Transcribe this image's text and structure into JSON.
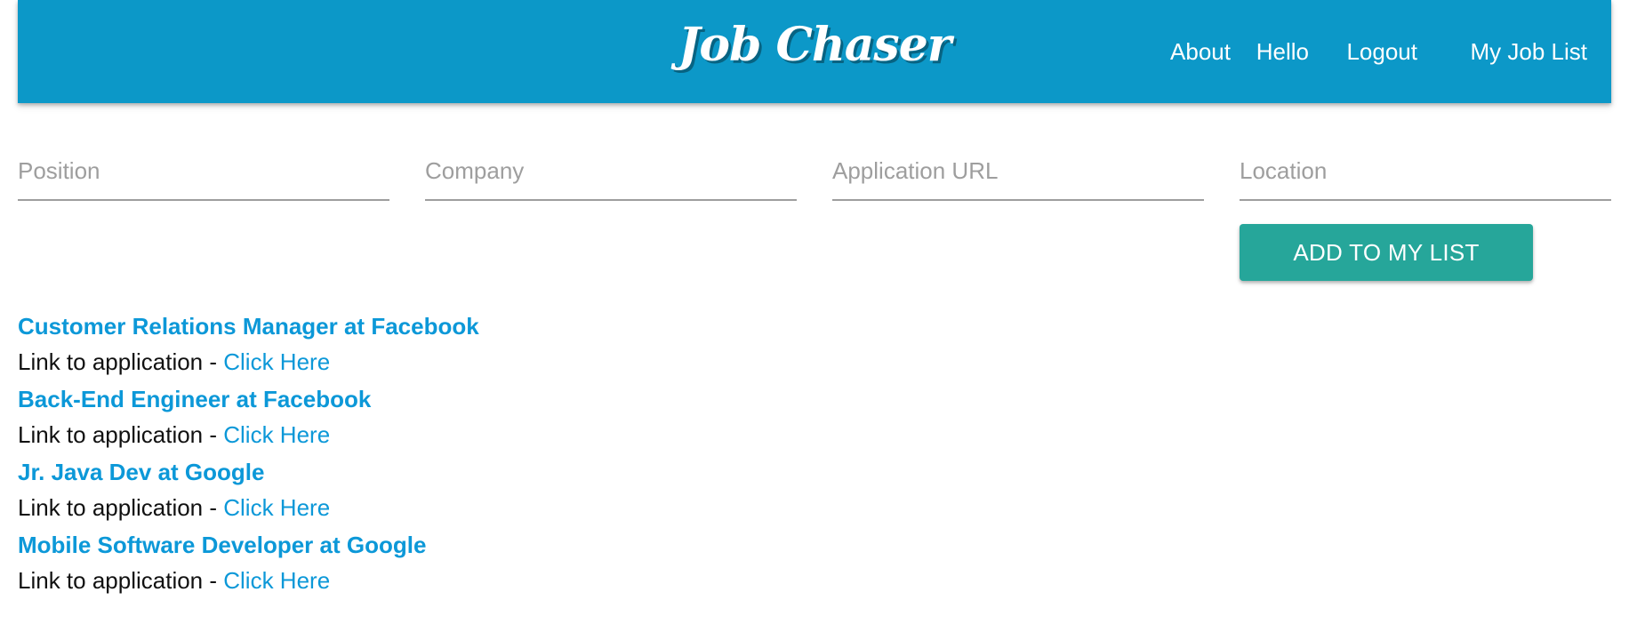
{
  "header": {
    "brand": "Job Chaser",
    "nav": [
      "About",
      "Hello",
      "Logout",
      "My Job List"
    ]
  },
  "form": {
    "position_placeholder": "Position",
    "company_placeholder": "Company",
    "url_placeholder": "Application URL",
    "location_placeholder": "Location",
    "add_button_label": "ADD TO MY LIST"
  },
  "jobs": [
    {
      "title": "Customer Relations Manager at Facebook",
      "link_prefix": "Link to application",
      "separator": " - ",
      "link_label": "Click Here"
    },
    {
      "title": "Back-End Engineer at Facebook",
      "link_prefix": "Link to application",
      "separator": " - ",
      "link_label": "Click Here"
    },
    {
      "title": "Jr. Java Dev at Google",
      "link_prefix": "Link to application",
      "separator": " - ",
      "link_label": "Click Here"
    },
    {
      "title": "Mobile Software Developer at Google",
      "link_prefix": "Link to application",
      "separator": " - ",
      "link_label": "Click Here"
    }
  ],
  "colors": {
    "header_bg": "#0c98c8",
    "link": "#0c98d8",
    "button_bg": "#26a69a",
    "input_underline": "#9e9e9e"
  }
}
